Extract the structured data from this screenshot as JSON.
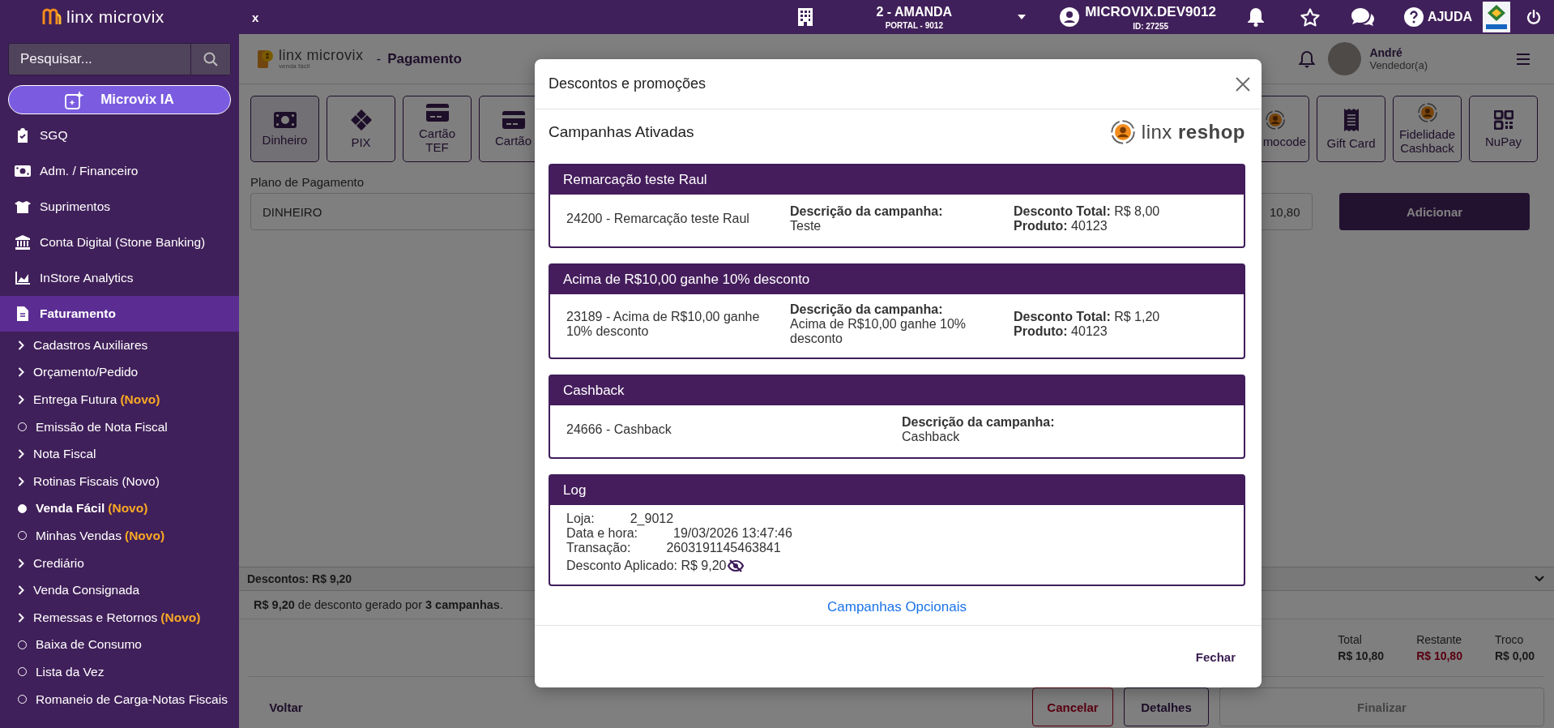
{
  "top_bar": {
    "brand": "linx microvix",
    "tab_close": "x",
    "store": {
      "name": "2 - AMANDA",
      "portal": "PORTAL - 9012"
    },
    "user": {
      "name": "MICROVIX.DEV9012",
      "id": "ID: 27255"
    },
    "help": "AJUDA"
  },
  "sidebar": {
    "search": {
      "placeholder": "Pesquisar..."
    },
    "ai_button": "Microvix IA",
    "modules": [
      {
        "label": "SGQ",
        "selected": false
      },
      {
        "label": "Adm. / Financeiro",
        "selected": false
      },
      {
        "label": "Suprimentos",
        "selected": false
      },
      {
        "label": "Conta Digital (Stone Banking)",
        "selected": false
      },
      {
        "label": "InStore Analytics",
        "selected": false
      },
      {
        "label": "Faturamento",
        "selected": true
      }
    ],
    "items": [
      {
        "kind": "group",
        "label": "Cadastros Auxiliares",
        "selected": false
      },
      {
        "kind": "group",
        "label": "Orçamento/Pedido",
        "selected": false
      },
      {
        "kind": "group",
        "label": "Entrega Futura",
        "badge": "(Novo)",
        "selected": false
      },
      {
        "kind": "page",
        "label": "Emissão de Nota Fiscal",
        "selected": false
      },
      {
        "kind": "group",
        "label": "Nota Fiscal",
        "selected": false
      },
      {
        "kind": "group",
        "label": "Rotinas Fiscais (Novo)",
        "selected": false
      },
      {
        "kind": "page",
        "label": "Venda Fácil",
        "badge": "(Novo)",
        "selected": true
      },
      {
        "kind": "page",
        "label": "Minhas Vendas",
        "badge": "(Novo)",
        "selected": false
      },
      {
        "kind": "group",
        "label": "Crediário",
        "selected": false
      },
      {
        "kind": "group",
        "label": "Venda Consignada",
        "selected": false
      },
      {
        "kind": "group",
        "label": "Remessas e Retornos",
        "badge": "(Novo)",
        "selected": false
      },
      {
        "kind": "page",
        "label": "Baixa de Consumo",
        "selected": false
      },
      {
        "kind": "page",
        "label": "Lista da Vez",
        "selected": false
      },
      {
        "kind": "page",
        "label": "Romaneio de Carga-Notas Fiscais",
        "selected": false
      }
    ]
  },
  "page": {
    "brand": "linx microvix",
    "brand_tagline": "venda fácil",
    "separator": "-",
    "title": "Pagamento",
    "user": {
      "name": "André",
      "role": "Vendedor(a)"
    },
    "methods_left": [
      {
        "label": "Dinheiro",
        "selected": true
      },
      {
        "label": "PIX",
        "selected": false
      },
      {
        "label": "Cartão TEF",
        "selected": false
      },
      {
        "label": "Cartão",
        "selected": false
      }
    ],
    "methods_right": [
      {
        "label": "mocode",
        "selected": false
      },
      {
        "label": "Gift Card",
        "selected": false
      },
      {
        "label": "Fidelidade Cashback",
        "selected": false
      },
      {
        "label": "NuPay",
        "selected": false
      }
    ],
    "plan_label": "Plano de Pagamento",
    "plan_value": "DINHEIRO",
    "amount_value": "10,80",
    "add_button": "Adicionar",
    "discounts": {
      "title": "Descontos: R$ 9,20",
      "summary": "**R$ 9,20** de desconto gerado por **3 campanhas**."
    },
    "totals": [
      {
        "label": "Total",
        "value": "R$ 10,80",
        "kind": "normal"
      },
      {
        "label": "Restante",
        "value": "R$ 10,80",
        "kind": "due"
      },
      {
        "label": "Troco",
        "value": "R$ 0,00",
        "kind": "normal"
      }
    ],
    "actions": [
      {
        "label": "Voltar",
        "kind": "text"
      },
      {
        "label": "Cancelar",
        "kind": "danger"
      },
      {
        "label": "Detalhes",
        "kind": "outline"
      },
      {
        "label": "Finalizar",
        "kind": "wide"
      }
    ]
  },
  "modal": {
    "title": "Descontos e promoções",
    "section_title": "Campanhas Ativadas",
    "partner_logo": "linx **reshop**",
    "campaigns": [
      {
        "title": "Remarcação teste Raul",
        "name": "24200 - Remarcação teste Raul",
        "description_label": "Descrição da campanha:",
        "description": "Teste",
        "total_label": "Desconto Total:",
        "total": "R$ 8,00",
        "product_label": "Produto:",
        "product": "40123"
      },
      {
        "title": "Acima de R$10,00 ganhe 10% desconto",
        "name": "23189 - Acima de R$10,00 ganhe 10% desconto",
        "description_label": "Descrição da campanha:",
        "description": "Acima de R$10,00 ganhe 10% desconto",
        "total_label": "Desconto Total:",
        "total": "R$ 1,20",
        "product_label": "Produto:",
        "product": "40123"
      },
      {
        "title": "Cashback",
        "name": "24666 - Cashback",
        "description_label": "Descrição da campanha:",
        "description": "Cashback"
      }
    ],
    "log": {
      "title": "Log",
      "rows": [
        {
          "label": "Loja:",
          "value": "2_9012"
        },
        {
          "label": "Data e hora:",
          "value": "19/03/2026 13:47:46"
        },
        {
          "label": "Transação:",
          "value": "2603191145463841"
        }
      ],
      "applied": "Desconto Aplicado: R$ 9,20"
    },
    "optional_link": "Campanhas Opcionais",
    "close_button": "Fechar"
  }
}
